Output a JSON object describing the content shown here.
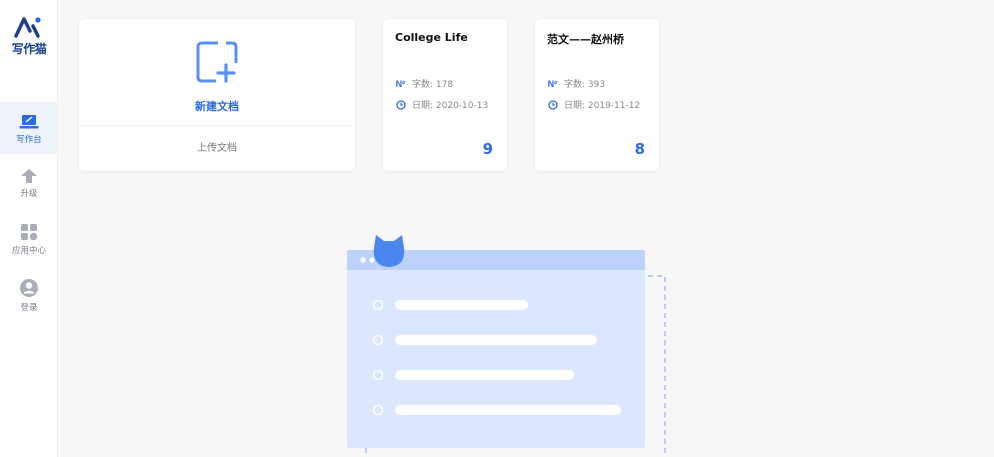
{
  "sidebar": {
    "logo_text": "写作猫",
    "items": [
      {
        "label": "写作台",
        "icon": "laptop-icon",
        "active": true
      },
      {
        "label": "升级",
        "icon": "arrow-up-icon",
        "active": false
      },
      {
        "label": "应用中心",
        "icon": "grid-icon",
        "active": false
      },
      {
        "label": "登录",
        "icon": "user-icon",
        "active": false
      }
    ]
  },
  "new_doc": {
    "create_label": "新建文档",
    "upload_label": "上传文档"
  },
  "documents": [
    {
      "title": "College Life",
      "word_label": "字数: 178",
      "date_label": "日期: 2020-10-13",
      "count": "9"
    },
    {
      "title": "范文——赵州桥",
      "word_label": "字数: 393",
      "date_label": "日期: 2019-11-12",
      "count": "8"
    }
  ],
  "colors": {
    "accent": "#2d6be0",
    "brand_dark": "#1b3f8c",
    "illustration_fill": "#dce7fd",
    "illustration_header": "#bcd1fb"
  }
}
